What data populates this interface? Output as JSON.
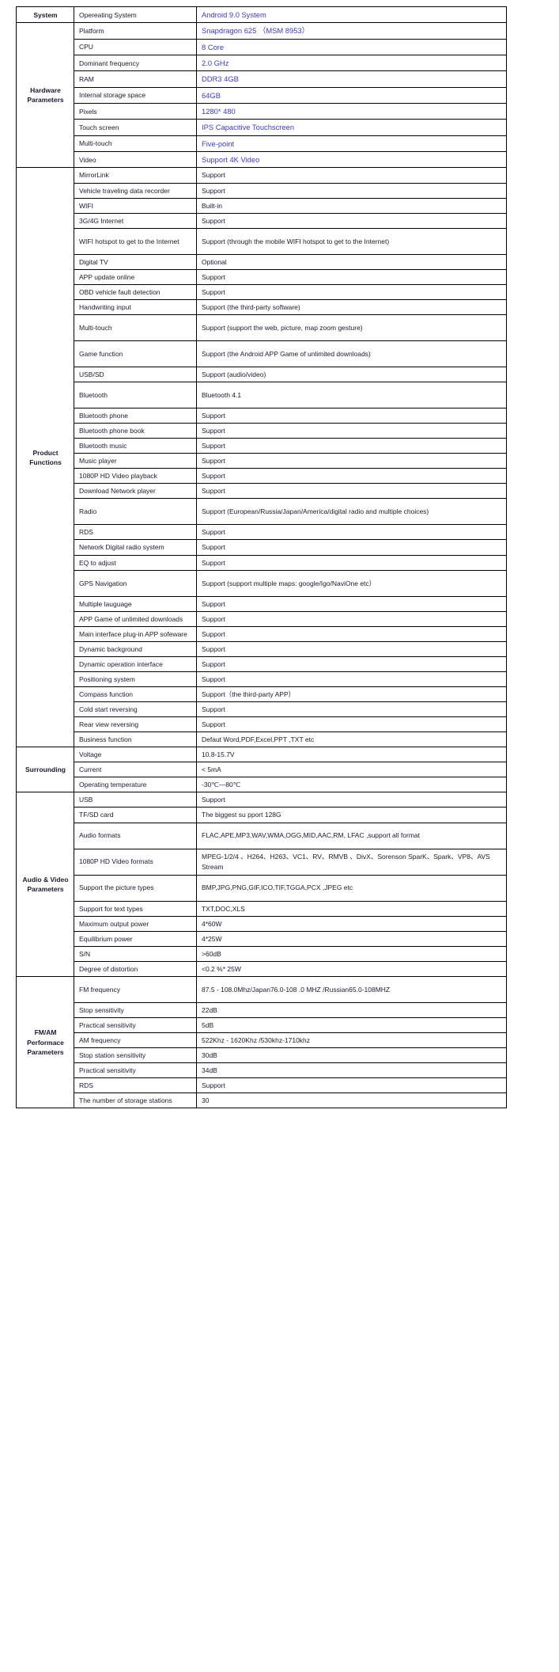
{
  "table": {
    "sections": [
      {
        "group": "System",
        "rows": [
          {
            "item": "Opereating System",
            "value": "Android 9.0 System",
            "accent": true
          }
        ]
      },
      {
        "group": "Hardware\nParameters",
        "group_lines": [
          "Hardware",
          "Parameters"
        ],
        "rows": [
          {
            "item": "Platform",
            "value": "Snapdragon 625 （MSM 8953）",
            "accent": true
          },
          {
            "item": "CPU",
            "value": "8 Core",
            "accent": true
          },
          {
            "item": "Dominant frequency",
            "value": "2.0 GHz",
            "accent": true
          },
          {
            "item": "RAM",
            "value": "DDR3  4GB",
            "accent": true
          },
          {
            "item": "Internal storage space",
            "value": "64GB",
            "accent": true
          },
          {
            "item": "Pixels",
            "value": "1280* 480",
            "accent": true
          },
          {
            "item": "Touch screen",
            "value": "IPS Capacitive Touchscreen",
            "accent": true
          },
          {
            "item": "Multi-touch",
            "value": "Five-point",
            "accent": true
          },
          {
            "item": "Video",
            "value": "Support 4K Video",
            "accent": true
          }
        ]
      },
      {
        "group": "Product\nFunctions",
        "group_lines": [
          "Product",
          "Functions"
        ],
        "rows": [
          {
            "item": "MirrorLink",
            "value": "Support",
            "accent": false
          },
          {
            "item": "Vehicle traveling data recorder",
            "value": "Support",
            "accent": false
          },
          {
            "item": "WIFI",
            "value": "Built-in",
            "accent": false
          },
          {
            "item": "3G/4G  Internet",
            "value": "Support",
            "accent": false
          },
          {
            "item": "WIFI hotspot to get to the Internet",
            "value": "Support (through the mobile WIFI hotspot to get to the Internet)",
            "accent": false,
            "tall": true
          },
          {
            "item": "Digital TV",
            "value": "Optional",
            "accent": false
          },
          {
            "item": "APP update online",
            "value": "Support",
            "accent": false
          },
          {
            "item": "OBD vehicle fault detection",
            "value": "Support",
            "accent": false
          },
          {
            "item": "Handwriting input",
            "value": "Support (the third-party software)",
            "accent": false
          },
          {
            "item": "Multi-touch",
            "value": "Support (support the web, picture, map zoom gesture)",
            "accent": false,
            "tall": true
          },
          {
            "item": "Game function",
            "value": "Support (the Android APP Game of unlimited downloads)",
            "accent": false,
            "tall": true
          },
          {
            "item": "USB/SD",
            "value": "Support (audio/video)",
            "accent": false
          },
          {
            "item": "Bluetooth",
            "value": "Bluetooth 4.1",
            "accent": false,
            "tall": true
          },
          {
            "item": "Bluetooth phone",
            "value": "Support",
            "accent": false
          },
          {
            "item": "Bluetooth phone book",
            "value": "Support",
            "accent": false
          },
          {
            "item": "Bluetooth music",
            "value": "Support",
            "accent": false
          },
          {
            "item": "Music player",
            "value": "Support",
            "accent": false
          },
          {
            "item": "1080P HD Video playback",
            "value": "Support",
            "accent": false
          },
          {
            "item": "Download Network player",
            "value": "Support",
            "accent": false
          },
          {
            "item": "Radio",
            "value": "Support (European/Russia/Japan/America/digital radio and multiple choices)",
            "accent": false,
            "tall": true
          },
          {
            "item": "RDS",
            "value": "Support",
            "accent": false
          },
          {
            "item": "Network Digital radio system",
            "value": "Support",
            "accent": false
          },
          {
            "item": "EQ to adjust",
            "value": "Support",
            "accent": false
          },
          {
            "item": "GPS Navigation",
            "value": "Support (support multiple maps: google/Igo/NaviOne etc）",
            "accent": false,
            "tall": true
          },
          {
            "item": "Multiple lauguage",
            "value": "Support",
            "accent": false
          },
          {
            "item": "APP Game of unlimited downloads",
            "value": "Support",
            "accent": false
          },
          {
            "item": "Main interface plug-in APP sofeware",
            "value": "Support",
            "accent": false
          },
          {
            "item": "Dynamic background",
            "value": "Support",
            "accent": false
          },
          {
            "item": "Dynamic operation interface",
            "value": "Support",
            "accent": false
          },
          {
            "item": "Positioning system",
            "value": "Support",
            "accent": false
          },
          {
            "item": "Compass function",
            "value": "Support（the third-party APP）",
            "accent": false
          },
          {
            "item": "Cold start reversing",
            "value": "Support",
            "accent": false
          },
          {
            "item": "Rear view reversing",
            "value": "Support",
            "accent": false
          },
          {
            "item": "Business function",
            "value": "Defaut Word,PDF,Excel,PPT ,TXT etc",
            "accent": false
          }
        ]
      },
      {
        "group": "Surrounding",
        "group_lines": [
          "Surrounding"
        ],
        "rows": [
          {
            "item": "Voltage",
            "value": "10.8-15.7V",
            "accent": false
          },
          {
            "item": "Current",
            "value": "< 5mA",
            "accent": false
          },
          {
            "item": "Operating temperature",
            "value": "-30℃—80℃",
            "accent": false
          }
        ]
      },
      {
        "group": "Audio & Video\nParameters",
        "group_lines": [
          "Audio & Video",
          "Parameters"
        ],
        "rows": [
          {
            "item": "USB",
            "value": "Support",
            "accent": false
          },
          {
            "item": "TF/SD card",
            "value": "The biggest su pport 128G",
            "accent": false
          },
          {
            "item": "Audio formats",
            "value": "FLAC,APE,MP3,WAV,WMA,OGG,MID,AAC,RM, LFAC ,support all format",
            "accent": false,
            "tall": true
          },
          {
            "item": "1080P HD Video formats",
            "value": "MPEG-1/2/4 、H264、H263、VC1、RV、RMVB 、DivX、Sorenson SparK、Spark、VP8、AVS Stream",
            "accent": false,
            "tall": true
          },
          {
            "item": "Support the picture types",
            "value": "BMP,JPG,PNG,GIF,ICO,TIF,TGGA,PCX ,JPEG etc",
            "accent": false,
            "tall": true
          },
          {
            "item": "Support for text types",
            "value": "TXT,DOC,XLS",
            "accent": false
          },
          {
            "item": "Maximum output power",
            "value": "4*60W",
            "accent": false
          },
          {
            "item": "Equilibrium power",
            "value": "4*25W",
            "accent": false
          },
          {
            "item": "S/N",
            "value": ">60dB",
            "accent": false
          },
          {
            "item": "Degree of distortion",
            "value": "<0.2 %* 25W",
            "accent": false
          }
        ]
      },
      {
        "group": "FM/AM\nPerformace\nParameters",
        "group_lines": [
          "FM/AM",
          "Performace",
          "Parameters"
        ],
        "rows": [
          {
            "item": "FM frequency",
            "value": "87.5 - 108.0Mhz/Japan76.0-108 .0 MHZ /Russian65.0-108MHZ",
            "accent": false,
            "tall": true
          },
          {
            "item": "Stop sensitivity",
            "value": "22dB",
            "accent": false
          },
          {
            "item": "Practical sensitivity",
            "value": "5dB",
            "accent": false
          },
          {
            "item": "AM frequency",
            "value": "522Khz - 1620Khz /530khz-1710khz",
            "accent": false
          },
          {
            "item": "Stop station sensitivity",
            "value": "30dB",
            "accent": false
          },
          {
            "item": "Practical sensitivity",
            "value": "34dB",
            "accent": false
          },
          {
            "item": "RDS",
            "value": "Support",
            "accent": false
          },
          {
            "item": "The number of storage stations",
            "value": "30",
            "accent": false
          }
        ]
      }
    ]
  }
}
